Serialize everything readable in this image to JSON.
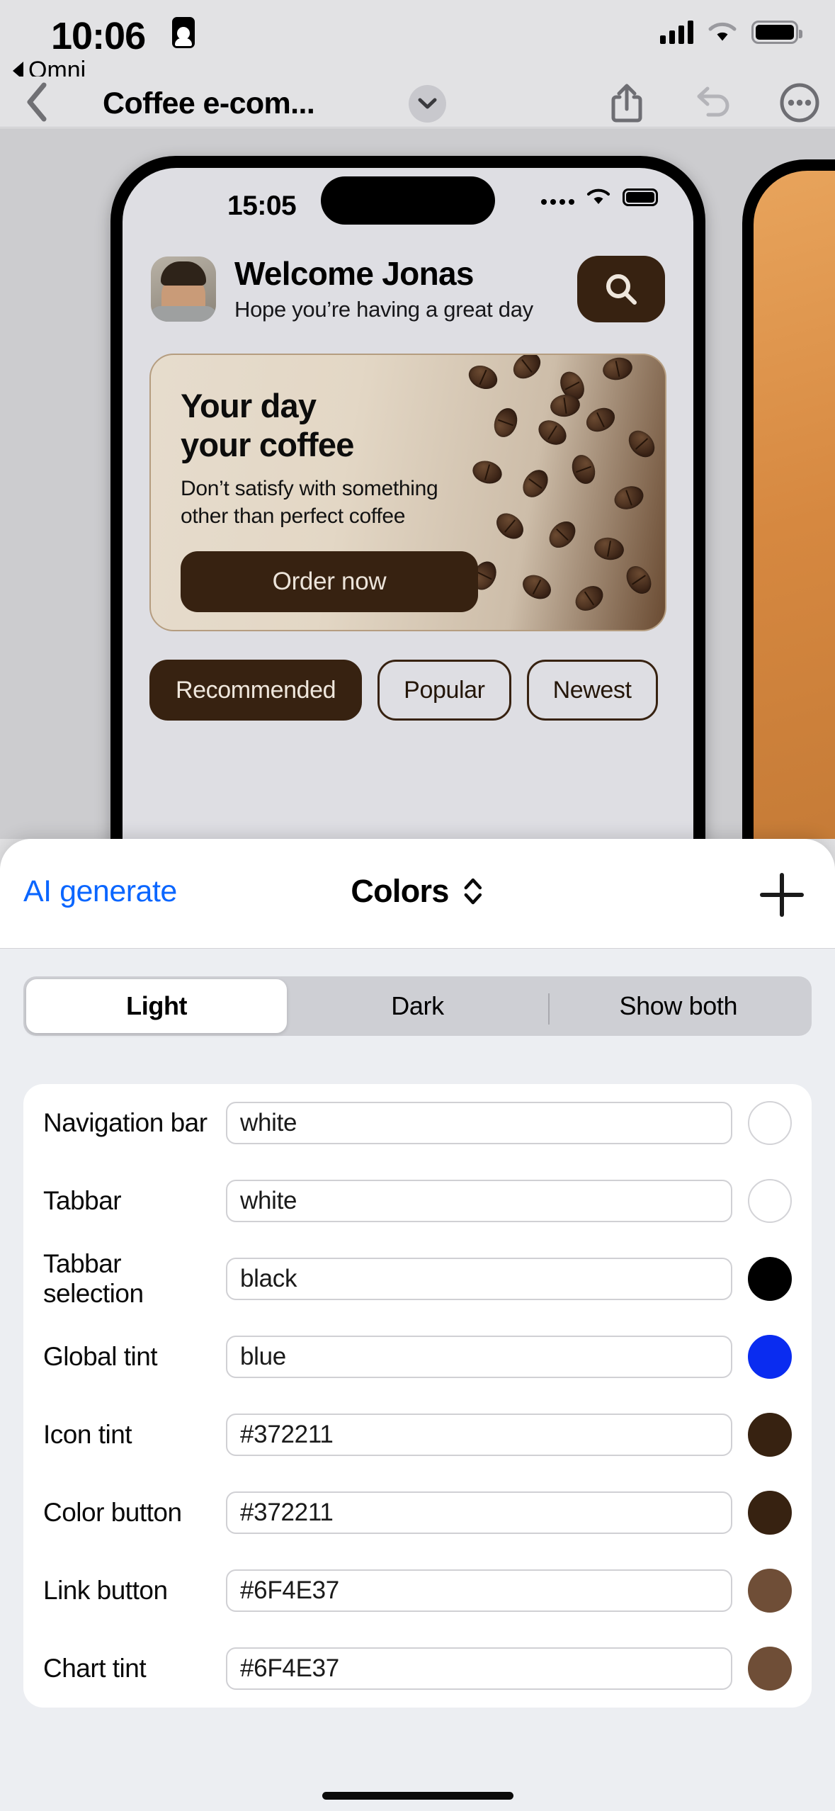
{
  "status_bar": {
    "time": "10:06",
    "recording_icon": "person-recording-icon",
    "back_app_label": "Omni",
    "cellular_icon": "cellular-bars-icon",
    "wifi_icon": "wifi-icon",
    "battery_icon": "battery-icon"
  },
  "navbar": {
    "back_icon": "chevron-left-icon",
    "title": "Coffee e-com...",
    "title_chevron_icon": "chevron-down-icon",
    "share_icon": "share-icon",
    "undo_icon": "undo-icon",
    "more_icon": "ellipsis-circle-icon"
  },
  "preview": {
    "phone_status": {
      "time": "15:05",
      "signal_icon": "signal-dots-icon",
      "wifi_icon": "wifi-icon",
      "battery_icon": "battery-icon"
    },
    "header": {
      "avatar": "user-avatar",
      "title": "Welcome Jonas",
      "subtitle": "Hope you’re having a great day",
      "search_icon": "search-icon"
    },
    "hero": {
      "heading_line1": "Your day",
      "heading_line2": "your coffee",
      "body_line1": "Don’t satisfy with something",
      "body_line2": "other than perfect coffee",
      "cta_label": "Order now"
    },
    "chips": [
      {
        "label": "Recommended",
        "active": true
      },
      {
        "label": "Popular",
        "active": false
      },
      {
        "label": "Newest",
        "active": false
      }
    ]
  },
  "sheet": {
    "ai_generate_label": "AI generate",
    "title": "Colors",
    "title_chevron_icon": "chevron-up-down-icon",
    "add_icon": "plus-icon",
    "segments": [
      {
        "label": "Light",
        "active": true
      },
      {
        "label": "Dark",
        "active": false
      },
      {
        "label": "Show both",
        "active": false
      }
    ],
    "rows": [
      {
        "label": "Navigation bar",
        "value": "white",
        "swatch": "#ffffff"
      },
      {
        "label": "Tabbar",
        "value": "white",
        "swatch": "#ffffff"
      },
      {
        "label": "Tabbar selection",
        "value": "black",
        "swatch": "#000000"
      },
      {
        "label": "Global tint",
        "value": "blue",
        "swatch": "#0a2cf0"
      },
      {
        "label": "Icon tint",
        "value": "#372211",
        "swatch": "#372211"
      },
      {
        "label": "Color button",
        "value": "#372211",
        "swatch": "#372211"
      },
      {
        "label": "Link button",
        "value": "#6F4E37",
        "swatch": "#6F4E37"
      },
      {
        "label": "Chart tint",
        "value": "#6F4E37",
        "swatch": "#6F4E37"
      }
    ]
  },
  "colors": {
    "accent_blue": "#0a66ff",
    "coffee_dark": "#372211",
    "coffee_mid": "#6F4E37"
  }
}
